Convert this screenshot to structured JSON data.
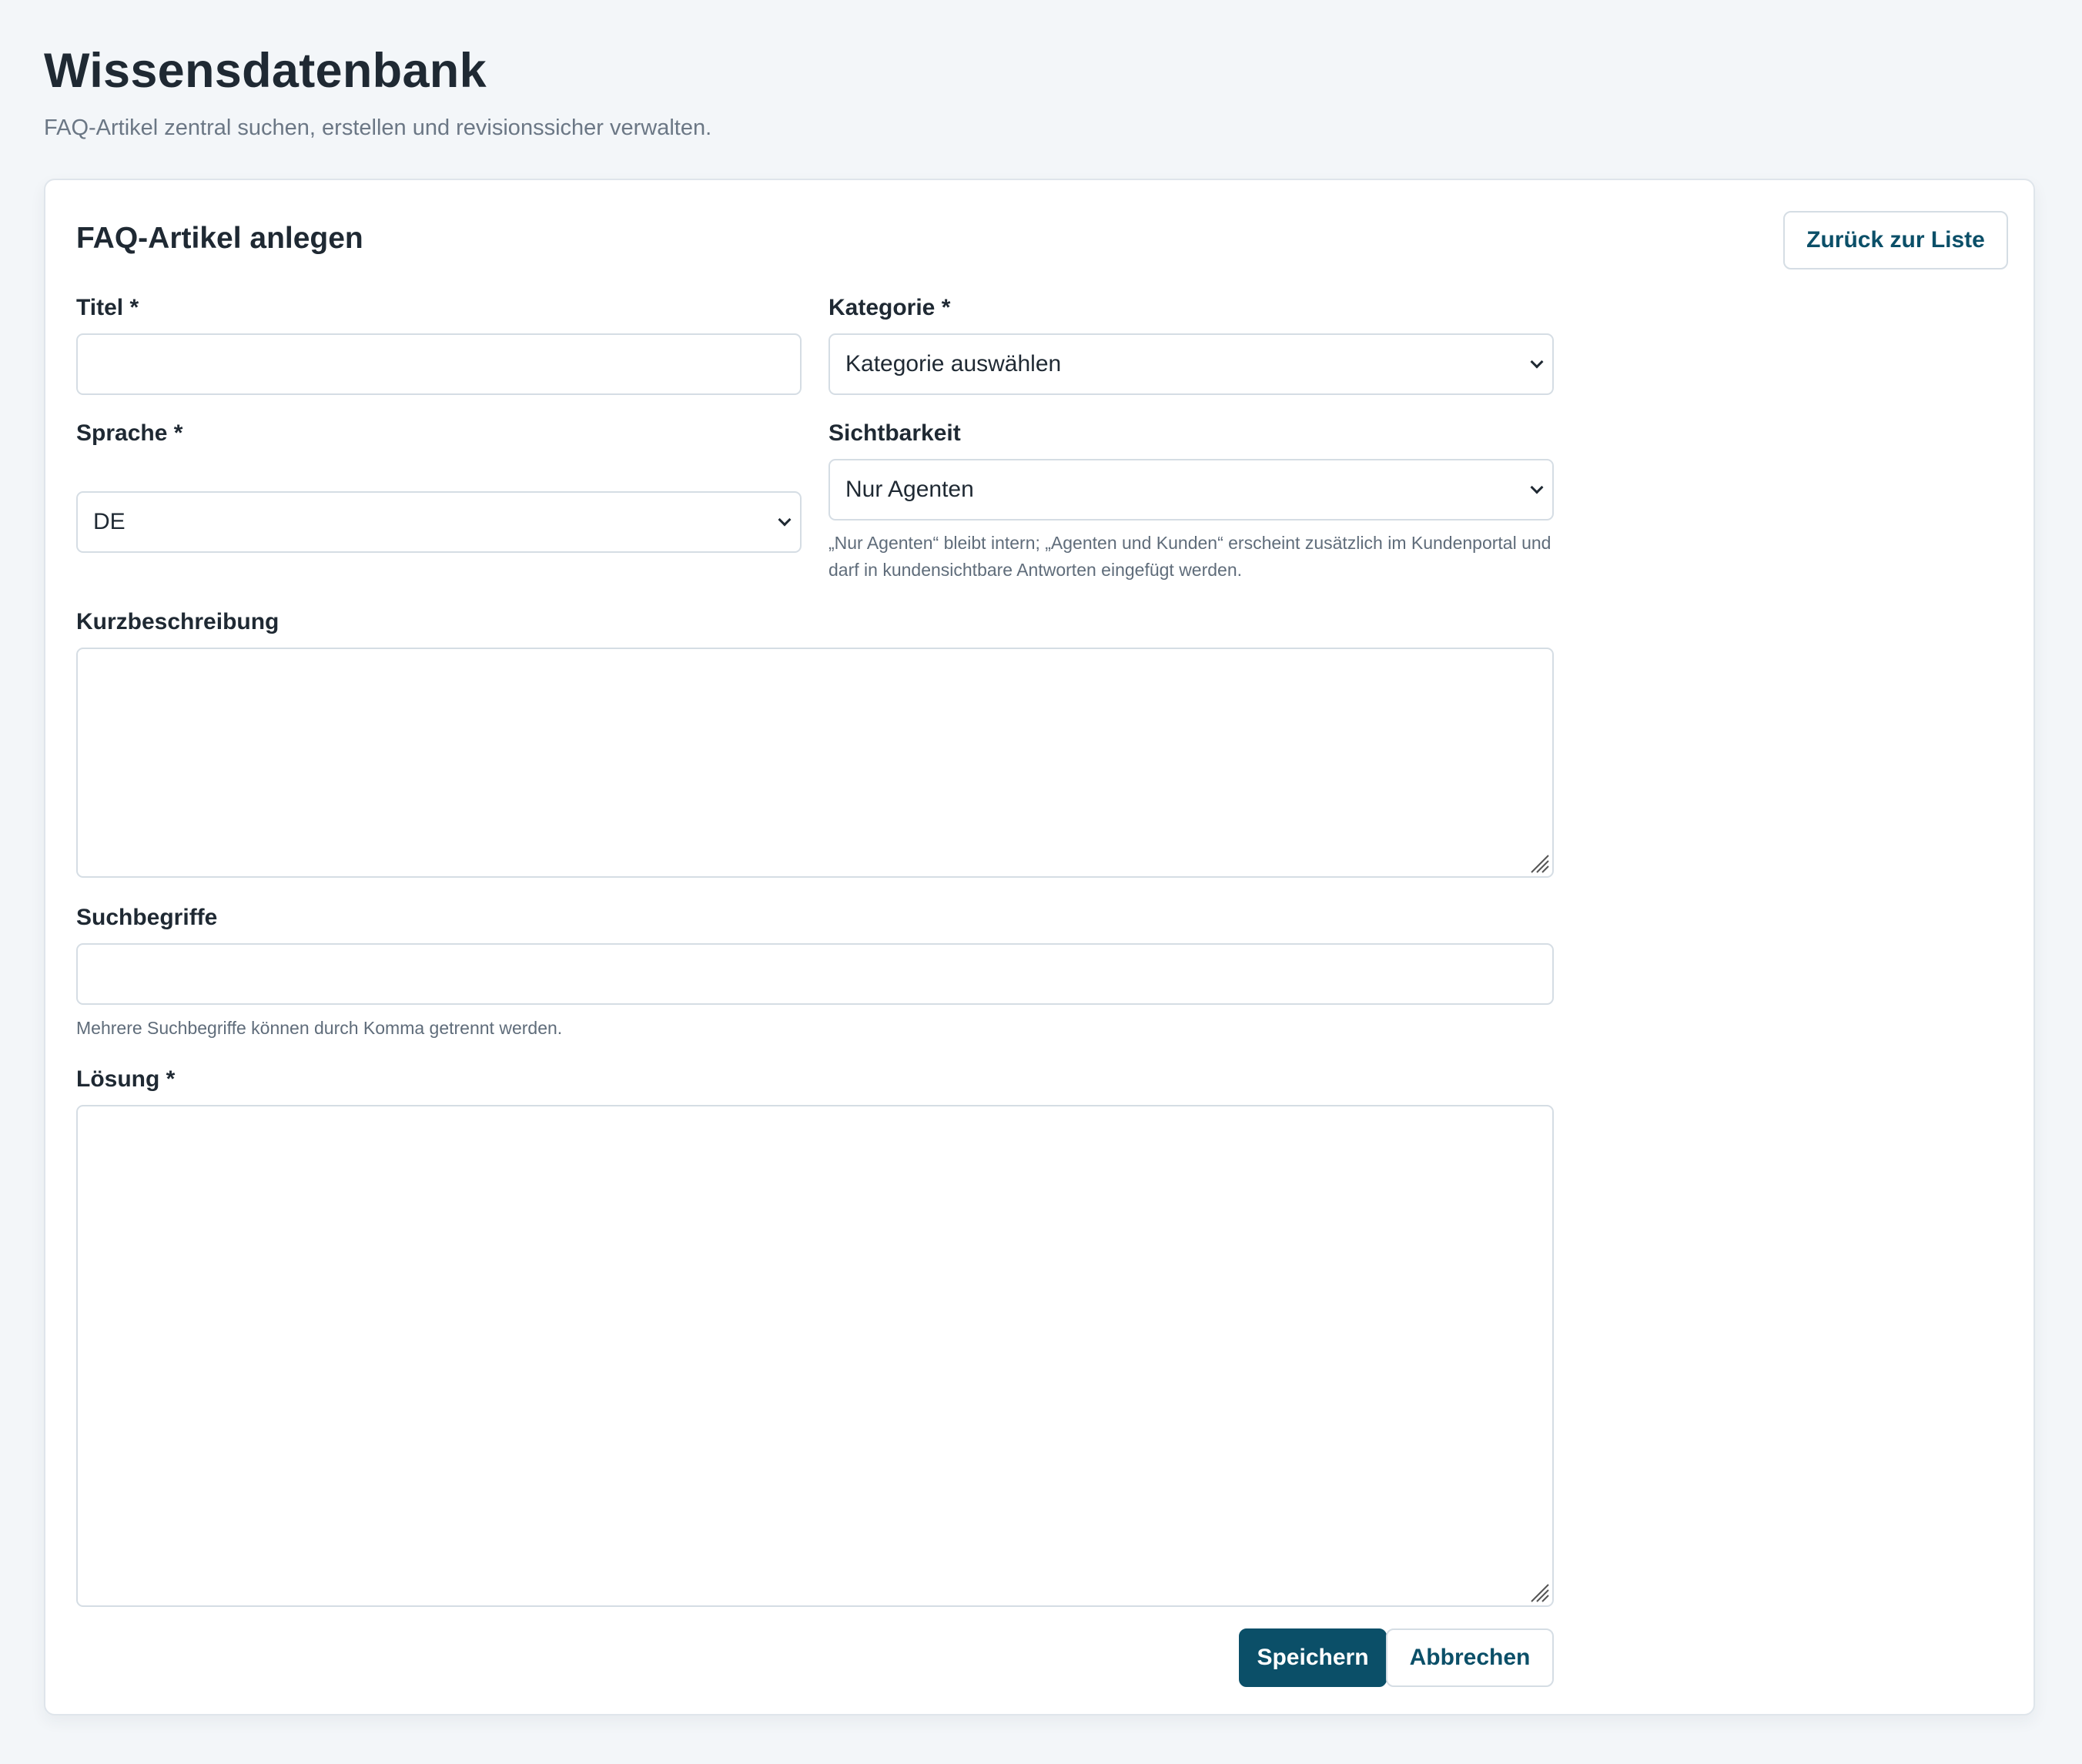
{
  "header": {
    "title": "Wissensdatenbank",
    "subtitle": "FAQ-Artikel zentral suchen, erstellen und revisionssicher verwalten."
  },
  "form": {
    "title": "FAQ-Artikel anlegen",
    "back_label": "Zurück zur Liste",
    "titel": {
      "label": "Titel *",
      "value": ""
    },
    "kategorie": {
      "label": "Kategorie *",
      "value": "Kategorie auswählen"
    },
    "sprache": {
      "label": "Sprache *",
      "value": "DE"
    },
    "sichtbarkeit": {
      "label": "Sichtbarkeit",
      "value": "Nur Agenten",
      "hint": "„Nur Agenten“ bleibt intern; „Agenten und Kunden“ erscheint zusätzlich im Kundenportal und darf in kundensichtbare Antworten eingefügt werden."
    },
    "kurzbeschreibung": {
      "label": "Kurzbeschreibung",
      "value": ""
    },
    "suchbegriffe": {
      "label": "Suchbegriffe",
      "value": "",
      "hint": "Mehrere Suchbegriffe können durch Komma getrennt werden."
    },
    "loesung": {
      "label": "Lösung *",
      "value": ""
    },
    "save_label": "Speichern",
    "cancel_label": "Abbrechen"
  },
  "colors": {
    "primary": "#0b4f68",
    "background": "#f3f6f9",
    "border": "#d5dde4",
    "muted_text": "#6b7785"
  },
  "icons": {
    "select_arrow": "chevron-down-icon",
    "textarea_resize": "resize-grip-icon"
  }
}
